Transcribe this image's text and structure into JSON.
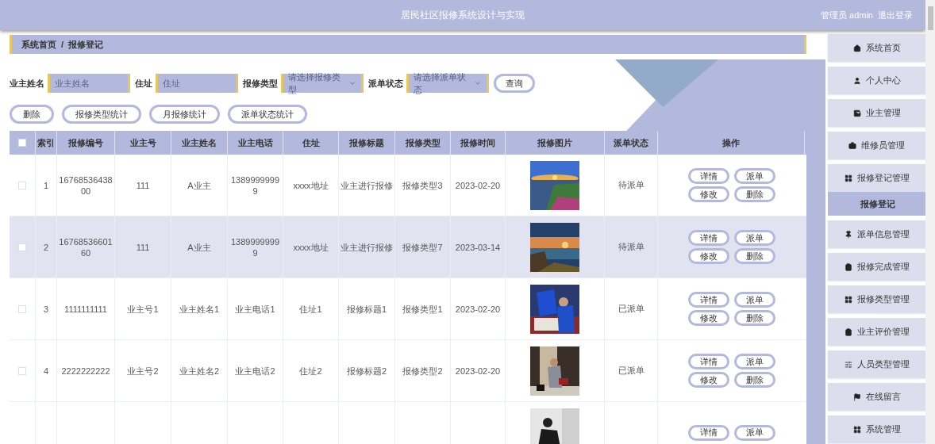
{
  "header": {
    "title": "居民社区报修系统设计与实现",
    "user": "管理员 admin",
    "logout": "退出登录"
  },
  "breadcrumb": [
    "系统首页",
    "/",
    "报修登记"
  ],
  "filters": [
    {
      "label": "业主姓名",
      "placeholder": "业主姓名",
      "kind": "input"
    },
    {
      "label": "住址",
      "placeholder": "住址",
      "kind": "input"
    },
    {
      "label": "报修类型",
      "placeholder": "请选择报修类型",
      "kind": "select"
    },
    {
      "label": "派单状态",
      "placeholder": "请选择派单状态",
      "kind": "select"
    }
  ],
  "search_button": "查询",
  "actions": [
    "删除",
    "报修类型统计",
    "月报修统计",
    "派单状态统计"
  ],
  "table": {
    "select_all": {
      "checked": false
    },
    "columns": [
      "索引",
      "报修编号",
      "业主号",
      "业主姓名",
      "业主电话",
      "住址",
      "报修标题",
      "报修类型",
      "报修时间",
      "报修图片",
      "派单状态",
      "操作"
    ],
    "rows": [
      {
        "checked": false,
        "highlighted": false,
        "cells": [
          "1",
          "1676853643800",
          "111",
          "A业主",
          "13899999999",
          "xxxx地址",
          "业主进行报修",
          "报修类型3",
          "2023-02-20"
        ],
        "status": "待派单",
        "buttons": [
          "详情",
          "派单",
          "修改",
          "删除"
        ]
      },
      {
        "checked": false,
        "highlighted": true,
        "cells": [
          "2",
          "1676853660160",
          "111",
          "A业主",
          "13899999999",
          "xxxx地址",
          "业主进行报修",
          "报修类型7",
          "2023-03-14"
        ],
        "status": "待派单",
        "buttons": [
          "详情",
          "派单",
          "修改",
          "删除"
        ]
      },
      {
        "checked": false,
        "highlighted": false,
        "cells": [
          "3",
          "1111111111",
          "业主号1",
          "业主姓名1",
          "业主电话1",
          "住址1",
          "报修标题1",
          "报修类型1",
          "2023-02-20"
        ],
        "status": "已派单",
        "buttons": [
          "详情",
          "派单",
          "修改",
          "删除"
        ]
      },
      {
        "checked": false,
        "highlighted": false,
        "cells": [
          "4",
          "2222222222",
          "业主号2",
          "业主姓名2",
          "业主电话2",
          "住址2",
          "报修标题2",
          "报修类型2",
          "2023-02-20"
        ],
        "status": "已派单",
        "buttons": [
          "详情",
          "派单",
          "修改",
          "删除"
        ]
      },
      {
        "highlighted": false,
        "buttons": [
          "详情",
          "派单"
        ]
      }
    ]
  },
  "sidebar": {
    "items": [
      {
        "label": "系统首页",
        "selected": false
      },
      {
        "label": "个人中心",
        "selected": false
      },
      {
        "label": "业主管理",
        "selected": false
      },
      {
        "label": "维修员管理",
        "selected": false
      },
      {
        "label": "报修登记管理",
        "selected": false,
        "children": [
          {
            "label": "报修登记",
            "selected": true
          }
        ]
      },
      {
        "label": "派单信息管理",
        "selected": false
      },
      {
        "label": "报修完成管理",
        "selected": false
      },
      {
        "label": "报修类型管理",
        "selected": false
      },
      {
        "label": "业主评价管理",
        "selected": false
      },
      {
        "label": "人员类型管理",
        "selected": false
      },
      {
        "label": "在线留言",
        "selected": false
      },
      {
        "label": "系统管理",
        "selected": false
      }
    ]
  }
}
